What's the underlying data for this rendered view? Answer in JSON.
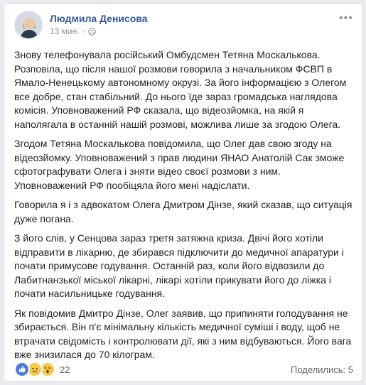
{
  "post": {
    "author": "Людмила Денисова",
    "time": "13 мин.",
    "separator": "·",
    "paragraphs": [
      "Знову телефонувала російський Омбудсмен Тетяна Москалькова. Розповіла, що після нашої розмови говорила з начальником ФСВП в Ямало-Ненецькому автономному окрузі. За його інформацією з Олегом все добре, стан стабільний. До нього їде зараз громадська наглядова комісія. Уповноважений РФ сказала, що відеозйомка, на якій я наполягала в останній нашій розмові, можлива лише за згодою Олега.",
      "Згодом Тетяна Москалькова повідомила, що Олег дав свою згоду на відеозйомку. Уповноважений з прав людини ЯНАО Анатолій Сак зможе сфотографувати Олега і зняти відео своєї розмови з ним. Уповноважений РФ пообіцяла його мені надіслати.",
      "Говорила я і з адвокатом Олега Дмитром Дінзе, який сказав, що ситуація дуже погана.",
      "З його слів, у Сенцова зараз третя затяжна криза. Двічі його хотіли відправити в лікарню, де збирався підключити до медичної апаратури і почати примусове годування. Останній раз, коли його відвозили до Лабитнанзької міської лікарні, лікарі хотіли прикувати його до ліжка і почати насильницьке годування.",
      "Як повідомив Дмитро Дінзе, Олег заявив, що припиняти голодування не збирається. Він п'є мінімальну кількість медичної суміші і воду, щоб не втрачати свідомість і контролювати дії, які з ним відбуваються. Його вага вже знизилася до 70 кілограм."
    ]
  },
  "footer": {
    "reaction_count": "22",
    "shares_text": "Поделились: 5",
    "reactions": [
      "like-icon",
      "sad-icon",
      "wow-icon"
    ]
  },
  "colors": {
    "author": "#385898",
    "text": "#1d2129",
    "meta": "#90949c",
    "background": "#e9ebee"
  }
}
